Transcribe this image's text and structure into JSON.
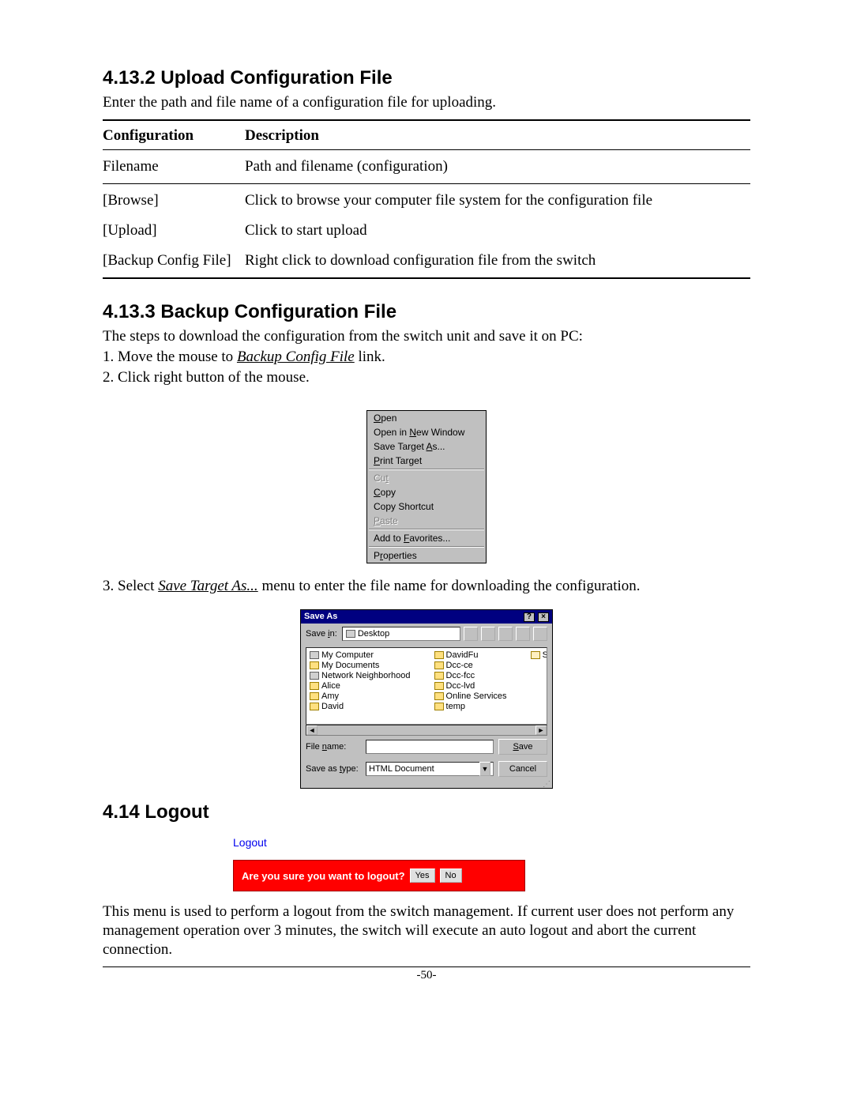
{
  "section1": {
    "heading": "4.13.2 Upload Configuration File",
    "intro": "Enter the path and file name of a configuration file for uploading.",
    "table": {
      "header1": "Configuration",
      "header2": "Description",
      "rows": [
        {
          "c": "Filename",
          "d": "Path and filename (configuration)"
        },
        {
          "c": "[Browse]",
          "d": "Click to browse your computer file system for the configuration file"
        },
        {
          "c": "[Upload]",
          "d": "Click to start upload"
        },
        {
          "c": "[Backup Config File]",
          "d": "Right click to download configuration file from the switch"
        }
      ]
    }
  },
  "section2": {
    "heading": "4.13.3 Backup Configuration File",
    "intro": "The steps to download the configuration from the switch unit and save it on PC:",
    "step1_prefix": "1. Move the mouse to ",
    "step1_link": "Backup Config File",
    "step1_suffix": " link.",
    "step2": "2. Click right button of the mouse.",
    "step3_prefix": "3. Select ",
    "step3_link": "Save Target As...",
    "step3_suffix": " menu to enter the file name for downloading the configuration."
  },
  "context_menu": {
    "open": "Open",
    "open_new": "Open in New Window",
    "save_target": "Save Target As...",
    "print_target": "Print Target",
    "cut": "Cut",
    "copy": "Copy",
    "copy_shortcut": "Copy Shortcut",
    "paste": "Paste",
    "add_fav": "Add to Favorites...",
    "properties": "Properties"
  },
  "saveas": {
    "title": "Save As",
    "savein_label": "Save in:",
    "savein_value": "Desktop",
    "col1": [
      "My Computer",
      "My Documents",
      "Network Neighborhood",
      "Alice",
      "Amy",
      "David"
    ],
    "col2": [
      "DavidFu",
      "Dcc-ce",
      "Dcc-fcc",
      "Dcc-lvd",
      "Online Services",
      "temp"
    ],
    "col3": [
      "Shortcut to My D"
    ],
    "filename_label": "File name:",
    "filename_value": "",
    "savetype_label": "Save as type:",
    "savetype_value": "HTML Document",
    "save_btn": "Save",
    "cancel_btn": "Cancel"
  },
  "section3": {
    "heading": "4.14 Logout",
    "title": "Logout",
    "prompt": "Are you sure you want to logout?",
    "yes": "Yes",
    "no": "No",
    "outro": "This menu is used to perform a logout from the switch management. If current user does not perform any management operation over 3 minutes, the switch will execute an auto logout and abort the current connection."
  },
  "page_number": "-50-"
}
